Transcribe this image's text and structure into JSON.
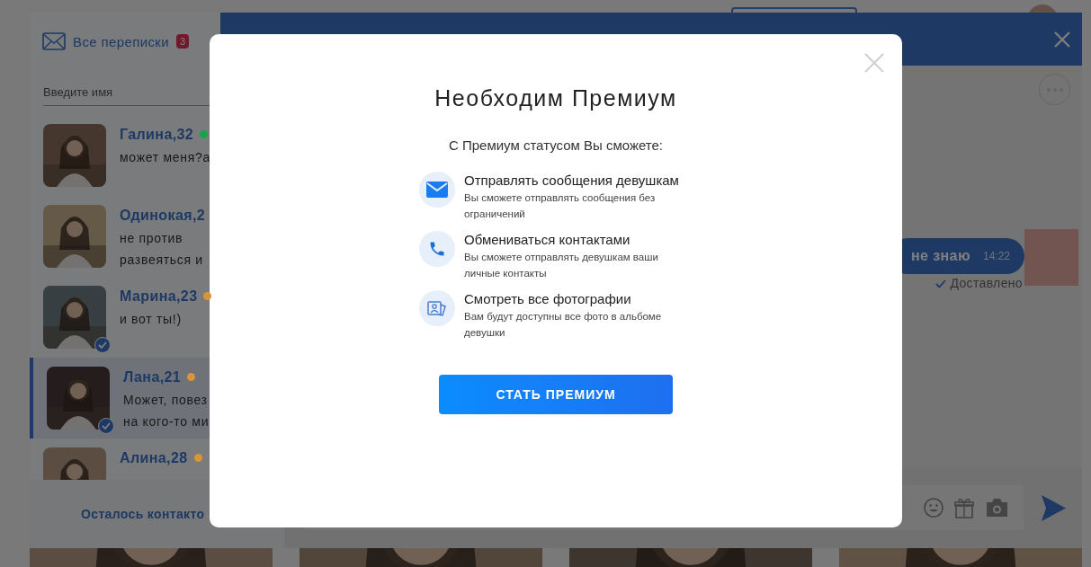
{
  "sidebar": {
    "title": "Все переписки",
    "badge": "3",
    "search": {
      "placeholder": "Введите имя"
    },
    "conversations": [
      {
        "name": "Галина,32",
        "color": "#16a34a",
        "preview": [
          "может меня?а"
        ],
        "verified": false,
        "selected": false
      },
      {
        "name": "Одинокая,2",
        "preview": [
          "не против",
          "развеяться и"
        ],
        "verified": false,
        "selected": false
      },
      {
        "name": "Марина,23",
        "color": "#d9953a",
        "preview": [
          "и вот ты!)"
        ],
        "verified": true,
        "selected": false
      },
      {
        "name": "Лана,21",
        "color": "#d9953a",
        "preview": [
          "Может, повез",
          "на кого-то ми"
        ],
        "verified": true,
        "selected": true
      },
      {
        "name": "Алина,28",
        "color": "#d9953a",
        "verified": false,
        "selected": false
      }
    ],
    "footer": "Осталось контакто"
  },
  "chat": {
    "messages": [
      {
        "text": "не знаю",
        "time": "14:22",
        "status": "Доставлено"
      }
    ]
  },
  "modal": {
    "title": "Необходим Премиум",
    "subtitle": "С Премиум статусом Вы сможете:",
    "features": [
      {
        "kind": "mail",
        "title": "Отправлять сообщения девушкам",
        "text": "Вы сможете отправлять сообщения без ограничений"
      },
      {
        "kind": "phone",
        "title": "Обмениваться контактами",
        "text": "Вы сможете отправлять девушкам ваши личные контакты"
      },
      {
        "kind": "photos",
        "title": "Смотреть все фотографии",
        "text": "Вам будут доступны все фото в альбоме девушки"
      }
    ],
    "button": "СТАТЬ ПРЕМИУМ"
  }
}
